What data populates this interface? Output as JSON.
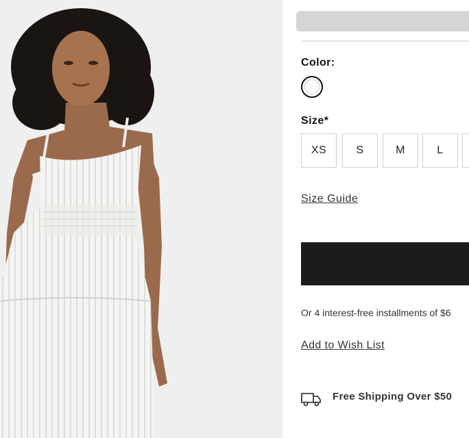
{
  "product": {
    "image_alt": "Model wearing white pinstripe tiered sundress"
  },
  "options": {
    "color_label": "Color:",
    "selected_color": "white",
    "size_label": "Size*",
    "sizes": [
      "XS",
      "S",
      "M",
      "L"
    ],
    "size_guide": "Size Guide"
  },
  "purchase": {
    "installments_text": "Or 4 interest-free installments of $6",
    "wishlist_label": "Add to Wish List"
  },
  "shipping": {
    "text": "Free Shipping Over $50",
    "icon": "truck-icon"
  },
  "colors": {
    "button_dark": "#1c1c1c",
    "image_bg": "#efefef"
  }
}
